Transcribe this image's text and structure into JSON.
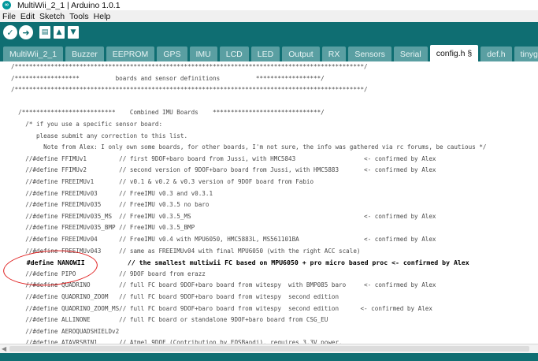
{
  "window": {
    "title": "MultiWii_2_1 | Arduino 1.0.1",
    "icon": "arduino-logo-icon"
  },
  "menu": [
    "File",
    "Edit",
    "Sketch",
    "Tools",
    "Help"
  ],
  "toolbar": {
    "buttons": [
      "verify-check-icon",
      "upload-arrow-icon",
      "new-file-icon",
      "open-arrow-up-icon",
      "save-arrow-down-icon"
    ]
  },
  "tabs": [
    {
      "label": "MultiWii_2_1",
      "active": false
    },
    {
      "label": "Buzzer",
      "active": false
    },
    {
      "label": "EEPROM",
      "active": false
    },
    {
      "label": "GPS",
      "active": false
    },
    {
      "label": "IMU",
      "active": false
    },
    {
      "label": "LCD",
      "active": false
    },
    {
      "label": "LED",
      "active": false
    },
    {
      "label": "Output",
      "active": false
    },
    {
      "label": "RX",
      "active": false
    },
    {
      "label": "Sensors",
      "active": false
    },
    {
      "label": "Serial",
      "active": false
    },
    {
      "label": "config.h §",
      "active": true
    },
    {
      "label": "def.h",
      "active": false
    },
    {
      "label": "tinygps.h",
      "active": false
    }
  ],
  "code_lines": [
    "/*************************************************************************************************/",
    "/******************          boards and sensor definitions          ******************/",
    "/*************************************************************************************************/",
    "",
    "  /**************************    Combined IMU Boards    ******************************/",
    "    /* if you use a specific sensor board:",
    "       please submit any correction to this list.",
    "         Note from Alex: I only own some boards, for other boards, I'm not sure, the info was gathered via rc forums, be cautious */",
    "    //#define FFIMUv1         // first 9DOF+baro board from Jussi, with HMC5843                   <- confirmed by Alex",
    "    //#define FFIMUv2         // second version of 9DOF+baro board from Jussi, with HMC5883       <- confirmed by Alex",
    "    //#define FREEIMUv1       // v0.1 & v0.2 & v0.3 version of 9DOF board from Fabio",
    "    //#define FREEIMUv03      // FreeIMU v0.3 and v0.3.1",
    "    //#define FREEIMUv035     // FreeIMU v0.3.5 no baro",
    "    //#define FREEIMUv035_MS  // FreeIMU v0.3.5_MS                                                <- confirmed by Alex",
    "    //#define FREEIMUv035_BMP // FreeIMU v0.3.5_BMP",
    "    //#define FREEIMUv04      // FreeIMU v0.4 with MPU6050, HMC5883L, MS561101BA                  <- confirmed by Alex",
    "    //#define FREEIMUv043     // same as FREEIMUv04 with final MPU6050 (with the right ACC scale)",
    "    #define NANOWII           // the smallest multiwii FC based on MPU6050 + pro micro based proc <- confirmed by Alex",
    "    //#define PIPO            // 9DOF board from erazz",
    "    //#define QUADRINO        // full FC board 9DOF+baro board from witespy  with BMP085 baro     <- confirmed by Alex",
    "    //#define QUADRINO_ZOOM   // full FC board 9DOF+baro board from witespy  second edition",
    "    //#define QUADRINO_ZOOM_MS// full FC board 9DOF+baro board from witespy  second edition      <- confirmed by Alex",
    "    //#define ALLINONE        // full FC board or standalone 9DOF+baro board from CSG_EU",
    "    //#define AEROQUADSHIELDv2",
    "    //#define ATAVRSBIN1      // Atmel 9DOF (Contribution by EOSBandi). requires 3.3V power."
  ],
  "highlight_line_index": 17,
  "annotation": {
    "shape": "hand-drawn-ellipse",
    "color": "#e02020"
  },
  "colors": {
    "toolbar_bg": "#0f6e72",
    "tab_inactive": "#5a9fa2",
    "tab_active": "#ffffff",
    "annotation": "#e02020"
  }
}
